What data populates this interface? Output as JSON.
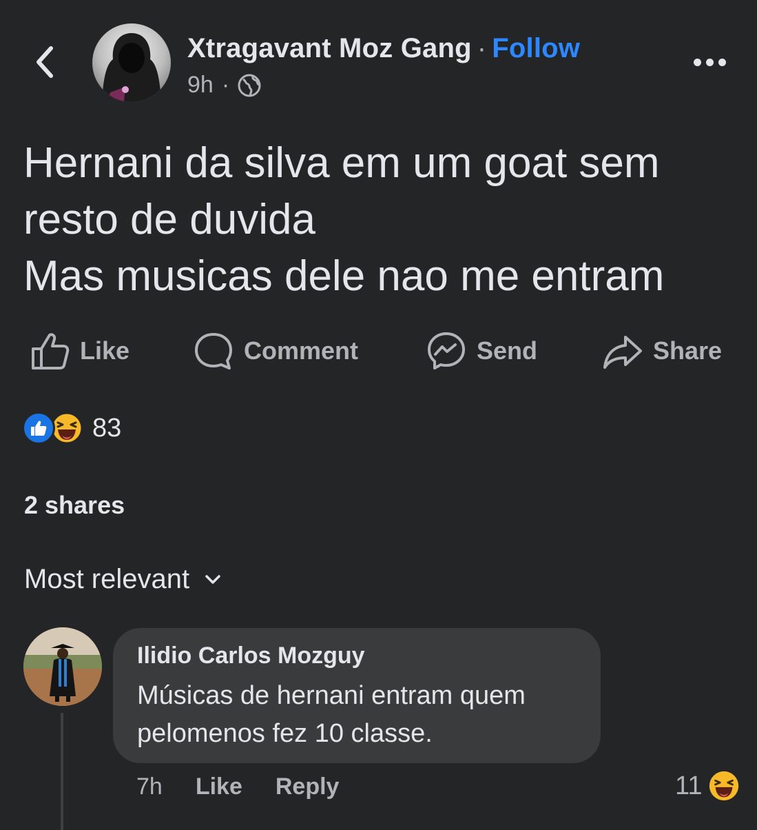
{
  "post": {
    "author": "Xtragavant Moz Gang",
    "separator": "·",
    "follow_label": "Follow",
    "time": "9h",
    "meta_separator": "·",
    "privacy_icon": "globe-icon",
    "text": "Hernani da silva em um goat sem\nresto de duvida\nMas musicas dele nao me entram"
  },
  "actions": {
    "like": "Like",
    "comment": "Comment",
    "send": "Send",
    "share": "Share"
  },
  "reactions": {
    "types": [
      "like",
      "haha"
    ],
    "count": "83"
  },
  "shares_label": "2 shares",
  "sort_label": "Most relevant",
  "comment": {
    "author": "Ilidio Carlos Mozguy",
    "text": "Músicas de hernani entram quem\npelomenos fez 10 classe.",
    "time": "7h",
    "like_label": "Like",
    "reply_label": "Reply",
    "reaction_count": "11",
    "reaction_type": "haha"
  },
  "colors": {
    "background": "#242526",
    "bubble": "#3a3b3c",
    "accent": "#2d88ff",
    "like_blue": "#1b74e4",
    "haha_yellow": "#f7b928"
  }
}
